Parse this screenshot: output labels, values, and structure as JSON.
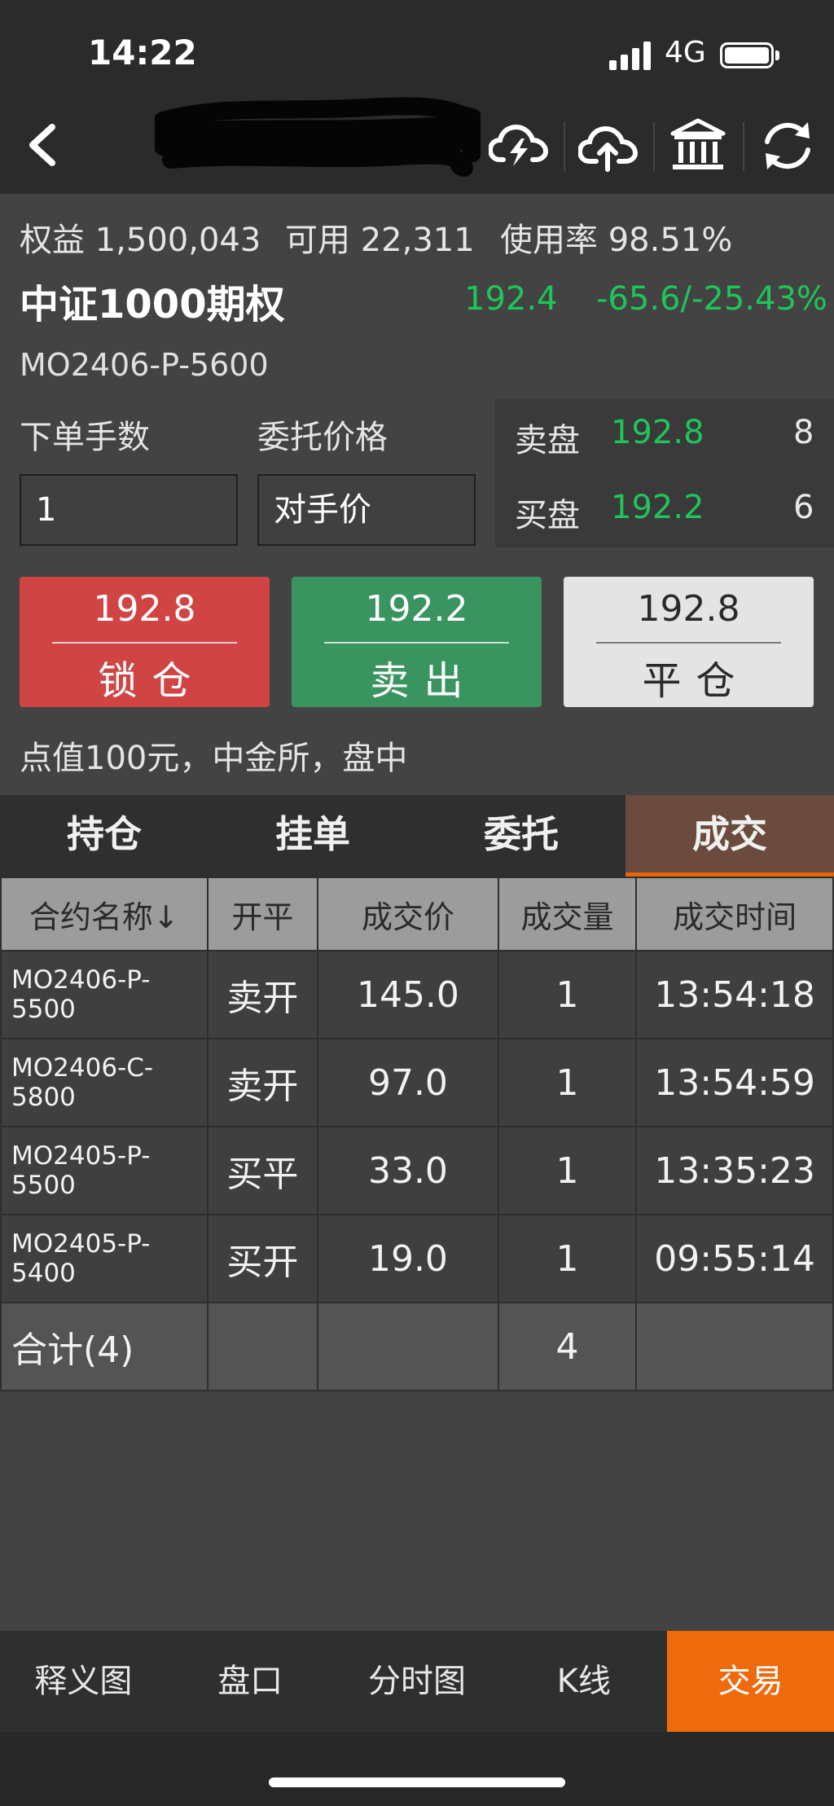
{
  "status": {
    "time": "14:22",
    "network": "4G"
  },
  "account": {
    "equity_label": "权益",
    "equity": "1,500,043",
    "available_label": "可用",
    "available": "22,311",
    "usage_label": "使用率",
    "usage": "98.51%"
  },
  "contract": {
    "title": "中证1000期权",
    "price": "192.4",
    "change": "-65.6/-25.43%",
    "code": "MO2406-P-5600"
  },
  "order": {
    "qty_label": "下单手数",
    "qty_value": "1",
    "price_label": "委托价格",
    "price_value": "对手价"
  },
  "quote": {
    "ask_label": "卖盘",
    "ask_price": "192.8",
    "ask_vol": "8",
    "bid_label": "买盘",
    "bid_price": "192.2",
    "bid_vol": "6"
  },
  "actions": [
    {
      "price": "192.8",
      "label": "锁仓",
      "color": "#d04444"
    },
    {
      "price": "192.2",
      "label": "卖出",
      "color": "#3a9460"
    },
    {
      "price": "192.8",
      "label": "平仓",
      "color": "#e4e4e4"
    }
  ],
  "note": "点值100元，中金所，盘中",
  "tabs": [
    {
      "label": "持仓"
    },
    {
      "label": "挂单"
    },
    {
      "label": "委托"
    },
    {
      "label": "成交",
      "active": true
    }
  ],
  "table": {
    "headers": [
      "合约名称↓",
      "开平",
      "成交价",
      "成交量",
      "成交时间"
    ],
    "rows": [
      {
        "name": "MO2406-P-5500",
        "dir": "卖开",
        "dir_color": "green",
        "price": "145.0",
        "vol": "1",
        "time": "13:54:18"
      },
      {
        "name": "MO2406-C-5800",
        "dir": "卖开",
        "dir_color": "green",
        "price": "97.0",
        "vol": "1",
        "time": "13:54:59"
      },
      {
        "name": "MO2405-P-5500",
        "dir": "买平",
        "dir_color": "red",
        "price": "33.0",
        "vol": "1",
        "time": "13:35:23"
      },
      {
        "name": "MO2405-P-5400",
        "dir": "买开",
        "dir_color": "red",
        "price": "19.0",
        "vol": "1",
        "time": "09:55:14"
      }
    ],
    "total": {
      "label": "合计(4)",
      "vol": "4"
    }
  },
  "bottom_nav": [
    {
      "label": "释义图"
    },
    {
      "label": "盘口"
    },
    {
      "label": "分时图"
    },
    {
      "label": "K线"
    },
    {
      "label": "交易",
      "active": true
    }
  ]
}
